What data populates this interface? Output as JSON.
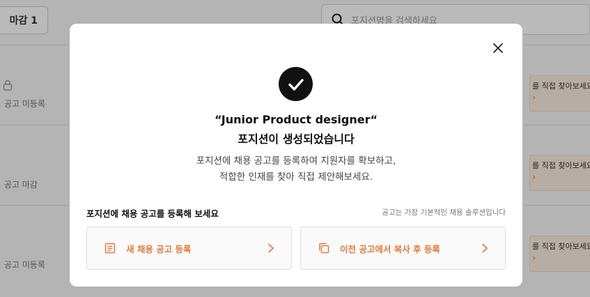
{
  "background": {
    "tab_label": "마감 1",
    "search_placeholder": "포지션명을 검색하세요",
    "rows": [
      {
        "status": "공고 미등록",
        "promo": "를 직접 찾아보세요!"
      },
      {
        "status": "공고 마감",
        "promo": "를 직접 찾아보세요!"
      },
      {
        "status": "공고 미등록",
        "promo": "를 직접 찾아보세요!"
      }
    ]
  },
  "modal": {
    "title_line1": "“Junior Product designer“",
    "title_line2": "포지션이 생성되었습니다",
    "desc_line1": "포지션에 채용 공고를 등록하여 지원자를 확보하고,",
    "desc_line2": "적합한 인재를 찾아 직접 제안해보세요.",
    "section_title": "포지션에 채용 공고를 등록해 보세요",
    "section_note": "공고는 가장 기본적인 채용 솔루션입니다",
    "options": [
      {
        "label": "새 채용 공고 등록",
        "icon": "document-icon"
      },
      {
        "label": "이전 공고에서 복사 후 등록",
        "icon": "copy-icon"
      }
    ]
  },
  "colors": {
    "accent": "#e07a3a",
    "overlay": "rgba(0,0,0,0.27)",
    "check_bg": "#111111"
  }
}
